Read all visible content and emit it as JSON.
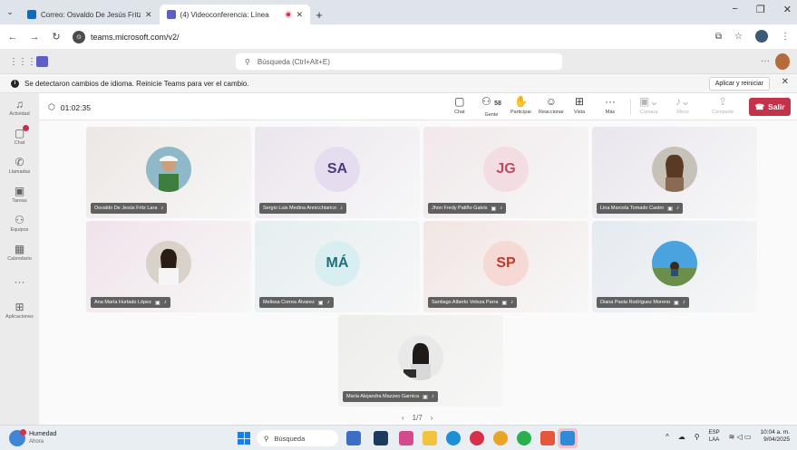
{
  "browser": {
    "menu_icon": "chevron-down",
    "tabs": [
      {
        "title": "Correo: Osvaldo De Jesús Fritz",
        "active": false
      },
      {
        "title": "(4) Videoconferencia: Línea",
        "active": true
      }
    ],
    "new_tab": "+",
    "url": "teams.microsoft.com/v2/",
    "win_min": "−",
    "win_max": "❐",
    "win_close": "✕"
  },
  "teams": {
    "search_placeholder": "Búsqueda (Ctrl+Alt+E)",
    "more": "···"
  },
  "banner": {
    "message": "Se detectaron cambios de idioma. Reinicie Teams para ver el cambio.",
    "action": "Aplicar y reiniciar",
    "close": "✕"
  },
  "rail": [
    {
      "label": "Actividad",
      "icon": "bell-icon"
    },
    {
      "label": "Chat",
      "icon": "chat-icon"
    },
    {
      "label": "Llamadas",
      "icon": "phone-icon"
    },
    {
      "label": "Tareas",
      "icon": "tasks-icon"
    },
    {
      "label": "Equipos",
      "icon": "teams-icon"
    },
    {
      "label": "Calendario",
      "icon": "calendar-icon"
    },
    {
      "label": "···",
      "icon": "more-icon"
    },
    {
      "label": "Aplicaciones",
      "icon": "plus-icon"
    }
  ],
  "meeting": {
    "timer": "01:02:35",
    "controls": {
      "chat": "Chat",
      "people": "Gente",
      "people_count": "58",
      "raise": "Participar",
      "react": "Reaccionar",
      "view": "Vista",
      "more": "Más",
      "camera": "Cámara",
      "mic": "Micro",
      "share": "Comparte",
      "leave": "Salir"
    },
    "participants": [
      {
        "name": "Osvaldo De Jesús Fritz Lara",
        "type": "photo",
        "initials": "",
        "bg": "#ece7e4"
      },
      {
        "name": "Sergio Luis Medina Annicchiarico",
        "type": "initials",
        "initials": "SA",
        "avatar_bg": "#e6dcf0",
        "avatar_fg": "#4b3a7a",
        "bg": "#ebe5ee"
      },
      {
        "name": "Jhon Fredy Patiño Galvis",
        "type": "initials",
        "initials": "JG",
        "avatar_bg": "#f3dde3",
        "avatar_fg": "#c0485e",
        "bg": "#f1e8ea"
      },
      {
        "name": "Lina Marcela Tomado Castro",
        "type": "photo",
        "initials": "",
        "bg": "#e9e6ee"
      },
      {
        "name": "Ana María Hurtado López",
        "type": "photo",
        "initials": "",
        "bg": "#f0e3ea"
      },
      {
        "name": "Melissa Correa Álvarez",
        "type": "initials",
        "initials": "MÁ",
        "avatar_bg": "#d9eef0",
        "avatar_fg": "#1f6f7d",
        "bg": "#e5eef0"
      },
      {
        "name": "Santiago Alberto Veloza Parra",
        "type": "initials",
        "initials": "SP",
        "avatar_bg": "#f6d8d4",
        "avatar_fg": "#c0392b",
        "bg": "#f1e6e4"
      },
      {
        "name": "Diana Paola Rodríguez Moreno",
        "type": "photo",
        "initials": "",
        "bg": "#e4eaf0"
      },
      {
        "name": "María Alejandra Mazzeo Garnica",
        "type": "photo",
        "initials": "",
        "bg": "#ededea"
      }
    ],
    "pager": {
      "prev": "‹",
      "page": "1/7",
      "next": "›"
    }
  },
  "taskbar": {
    "weather_title": "Humedad",
    "weather_sub": "Ahora",
    "search": "Búsqueda",
    "lang_1": "ESP",
    "lang_2": "LAA",
    "time": "10:04 a. m.",
    "date": "9/04/2025",
    "tray_arrow": "^"
  }
}
